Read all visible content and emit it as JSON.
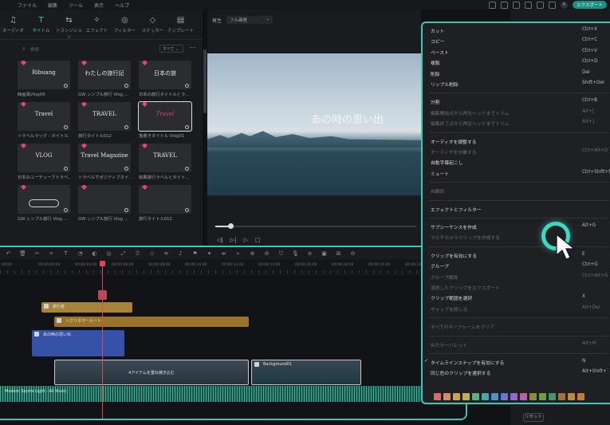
{
  "menubar": {
    "items": [
      "ファイル",
      "編集",
      "ツール",
      "表示",
      "ヘルプ"
    ],
    "avatar": "R",
    "export_label": "エクスポート"
  },
  "media": {
    "tabs": [
      {
        "label": "オーディオ",
        "icon": "♫",
        "active": false
      },
      {
        "label": "タイトル",
        "icon": "T",
        "active": true
      },
      {
        "label": "トランジション",
        "icon": "⇆",
        "active": false
      },
      {
        "label": "エフェクト",
        "icon": "✧",
        "active": false
      },
      {
        "label": "フィルター",
        "icon": "◎",
        "active": false
      },
      {
        "label": "ステッカー",
        "icon": "◇",
        "active": false
      },
      {
        "label": "テンプレート",
        "icon": "▤",
        "active": false
      }
    ],
    "search_placeholder": "検索",
    "filter_label": "すべて ⌄",
    "items": [
      {
        "thumb_text": "Ribuang",
        "caption": "映画風Vlog09",
        "style": "italic"
      },
      {
        "thumb_text": "わたしの旅行記",
        "caption": "GW シンプル旅行 Vlog ...",
        "style": ""
      },
      {
        "thumb_text": "日本の旅",
        "caption": "日本の旅行タイトルとラ...",
        "style": "badge"
      },
      {
        "thumb_text": "Travel",
        "caption": "トラベルラック - タイトル ...",
        "style": "serif"
      },
      {
        "thumb_text": "TRAVEL",
        "caption": "旅行タイトル012",
        "style": ""
      },
      {
        "thumb_text": "Travel",
        "caption": "落書きタイトル Vlog01",
        "style": "red"
      },
      {
        "thumb_text": "VLOG",
        "caption": "日本のユーチューブトラベ...",
        "style": ""
      },
      {
        "thumb_text": "Travel Magazine",
        "caption": "トラベルでポジティブタイ...",
        "style": ""
      },
      {
        "thumb_text": "TRAVEL",
        "caption": "和風旅行ラベルとタイト...",
        "style": "badge"
      },
      {
        "thumb_text": "",
        "caption": "GW シンプル旅行 Vlog ...",
        "style": "pill"
      },
      {
        "thumb_text": "",
        "caption": "GW シンプル旅行 Vlog ...",
        "style": ""
      },
      {
        "thumb_text": "",
        "caption": "旅行タイトル012",
        "style": ""
      }
    ]
  },
  "preview": {
    "label": "再生",
    "quality": "フル画質",
    "video_text": "あの時の思い出"
  },
  "timeline": {
    "ruler": [
      "00:00",
      "00:00:02:00",
      "00:00:04:00",
      "00:00:06:00",
      "00:00:08:00",
      "00:00:10:00",
      "00:00:12:00",
      "00:00:14:00",
      "00:00:16:00",
      "00:00:18:00",
      "00:00:20:00",
      "00:00:22:00"
    ],
    "clips": {
      "subtitle1": "旅行者",
      "subtitle2": "ソグリタマールート",
      "title": "あの時の思い出",
      "video_group": "4アイテムを重ね焼き込む",
      "background": "Background01",
      "audio": "Modern Sports Light - Ali Music"
    }
  },
  "context_menu": {
    "items": [
      {
        "label": "カット",
        "shortcut": "Ctrl+X",
        "disabled": false
      },
      {
        "label": "コピー",
        "shortcut": "Ctrl+C",
        "disabled": false
      },
      {
        "label": "ペースト",
        "shortcut": "Ctrl+V",
        "disabled": false
      },
      {
        "label": "複製",
        "shortcut": "Ctrl+D",
        "disabled": false
      },
      {
        "label": "削除",
        "shortcut": "Del",
        "disabled": false
      },
      {
        "label": "リップル削除",
        "shortcut": "Shift+Del",
        "disabled": false
      },
      {
        "label": "分割",
        "shortcut": "Ctrl+B",
        "disabled": false
      },
      {
        "label": "編集開始点から再生ヘッドまでトリム",
        "shortcut": "Alt+[",
        "disabled": true
      },
      {
        "label": "編集終了点から再生ヘッドまでトリム",
        "shortcut": "Alt+]",
        "disabled": true
      },
      {
        "label": "オーディオを調整する",
        "shortcut": "",
        "disabled": false
      },
      {
        "label": "オーディオを分離する",
        "shortcut": "Ctrl+Alt+D",
        "disabled": true
      },
      {
        "label": "自動字幕起こし",
        "shortcut": "",
        "disabled": false
      },
      {
        "label": "ミュート",
        "shortcut": "Ctrl+Shift+M",
        "disabled": false
      },
      {
        "label": "AI翻訳",
        "shortcut": "",
        "disabled": true
      },
      {
        "label": "エフェクトとフィルター",
        "shortcut": "",
        "disabled": false
      },
      {
        "label": "サブシーケンスを作成",
        "shortcut": "Alt+G",
        "disabled": false
      },
      {
        "label": "マルチカメラクリップを作成する",
        "shortcut": "",
        "disabled": true
      },
      {
        "label": "クリップを有効にする",
        "shortcut": "E",
        "disabled": false
      },
      {
        "label": "グループ",
        "shortcut": "Ctrl+G",
        "disabled": false
      },
      {
        "label": "グループ解除",
        "shortcut": "Ctrl+Alt+G",
        "disabled": true
      },
      {
        "label": "選択したクリップをエクスポート",
        "shortcut": "",
        "disabled": true
      },
      {
        "label": "クリップ範囲を選択",
        "shortcut": "X",
        "disabled": false
      },
      {
        "label": "ギャップを閉じる",
        "shortcut": "Alt+Del",
        "disabled": true
      },
      {
        "label": "すべてのキーフレームをクリア",
        "shortcut": "",
        "disabled": true
      },
      {
        "label": "AIカラーパレット",
        "shortcut": "Alt+M",
        "disabled": true
      },
      {
        "label": "タイムラインスナップを有効にする",
        "shortcut": "N",
        "disabled": false,
        "checked": true
      },
      {
        "label": "同じ色のクリップを選択する",
        "shortcut": "Alt+Shift+`",
        "disabled": false
      }
    ],
    "swatches": [
      "#d46a6a",
      "#d58a63",
      "#cfa24c",
      "#b7b35a",
      "#5cae83",
      "#45a8a5",
      "#4f8fd0",
      "#6d73cf",
      "#9567c9",
      "#b85fa6",
      "#8a8c3f",
      "#6f9c4a",
      "#4c8f6a",
      "#a0733e",
      "#c08a3e",
      "#c87a35"
    ]
  },
  "right_panel": {
    "reset_label": "リセット"
  }
}
